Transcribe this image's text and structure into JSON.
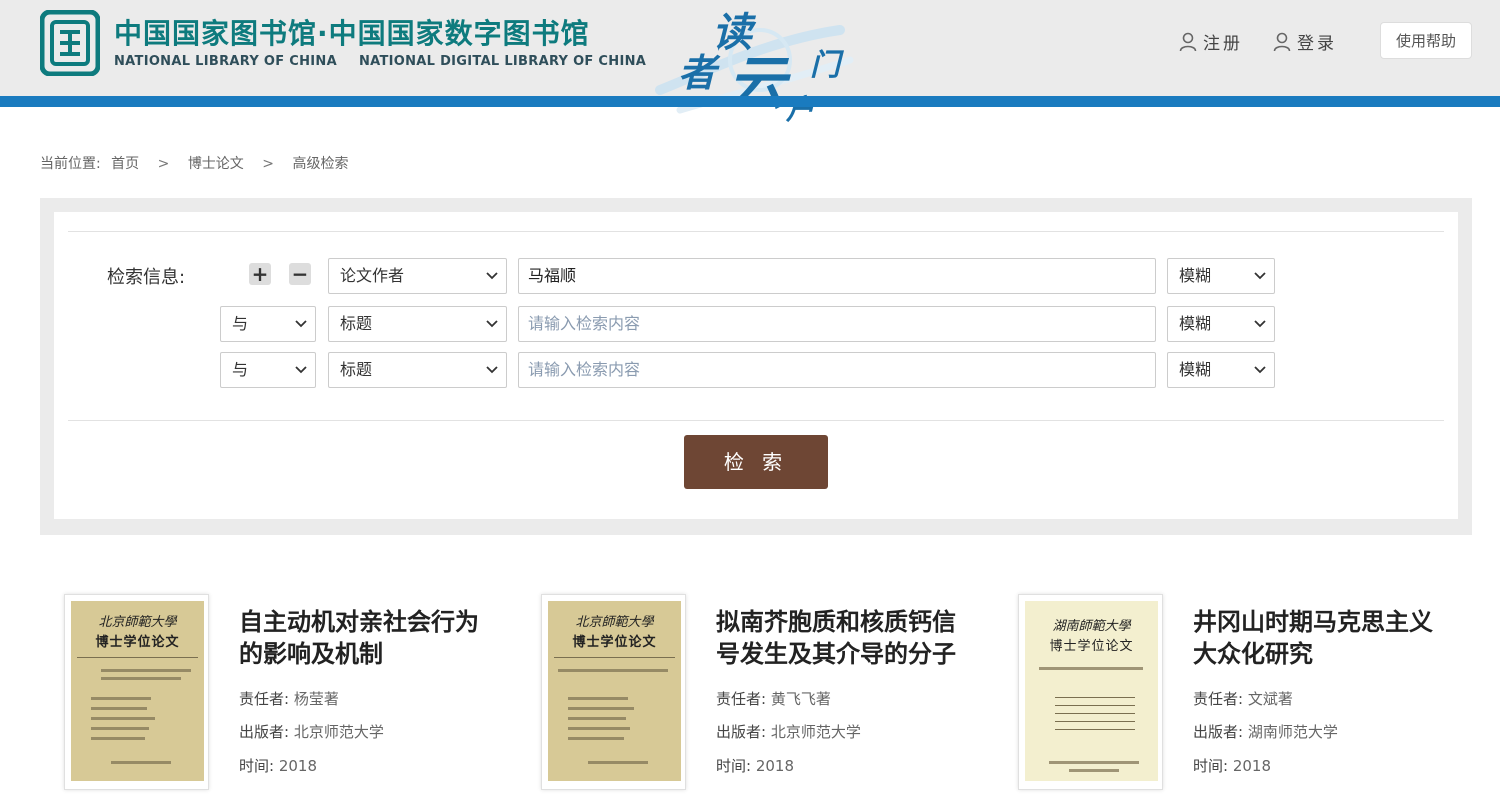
{
  "header": {
    "logo_cn": "中国国家图书馆·中国国家数字图书馆",
    "logo_en_1": "NATIONAL LIBRARY OF CHINA",
    "logo_en_2": "NATIONAL DIGITAL LIBRARY OF CHINA",
    "portal_chars": [
      "读",
      "者",
      "云",
      "门",
      "户"
    ],
    "register_label": "注册",
    "login_label": "登录",
    "help_label": "使用帮助"
  },
  "breadcrumb": {
    "prefix": "当前位置:",
    "items": [
      "首页",
      "博士论文",
      "高级检索"
    ],
    "separator": ">"
  },
  "search": {
    "label": "检索信息:",
    "plus_label": "+",
    "minus_label": "−",
    "rows": [
      {
        "logic": "",
        "field": "论文作者",
        "value": "马福顺",
        "placeholder": "",
        "mode": "模糊"
      },
      {
        "logic": "与",
        "field": "标题",
        "value": "",
        "placeholder": "请输入检索内容",
        "mode": "模糊"
      },
      {
        "logic": "与",
        "field": "标题",
        "value": "",
        "placeholder": "请输入检索内容",
        "mode": "模糊"
      }
    ],
    "submit_label": "检 索"
  },
  "results": [
    {
      "title": "自主动机对亲社会行为的影响及机制",
      "responsible_label": "责任者:",
      "responsible": "杨莹著",
      "publisher_label": "出版者:",
      "publisher": "北京师范大学",
      "time_label": "时间:",
      "time": "2018",
      "cover_school": "北京師範大學",
      "cover_title": "博士学位论文"
    },
    {
      "title": "拟南芥胞质和核质钙信号发生及其介导的分子",
      "responsible_label": "责任者:",
      "responsible": "黄飞飞著",
      "publisher_label": "出版者:",
      "publisher": "北京师范大学",
      "time_label": "时间:",
      "time": "2018",
      "cover_school": "北京師範大學",
      "cover_title": "博士学位论文"
    },
    {
      "title": "井冈山时期马克思主义大众化研究",
      "responsible_label": "责任者:",
      "responsible": "文斌著",
      "publisher_label": "出版者:",
      "publisher": "湖南师范大学",
      "time_label": "时间:",
      "time": "2018",
      "cover_school": "湖南師範大學",
      "cover_title": "博士学位论文"
    }
  ],
  "colors": {
    "brand_teal": "#0e7b7e",
    "header_bar": "#1a7bbf",
    "submit_button": "#6e4634",
    "panel_bg": "#ebebeb"
  }
}
